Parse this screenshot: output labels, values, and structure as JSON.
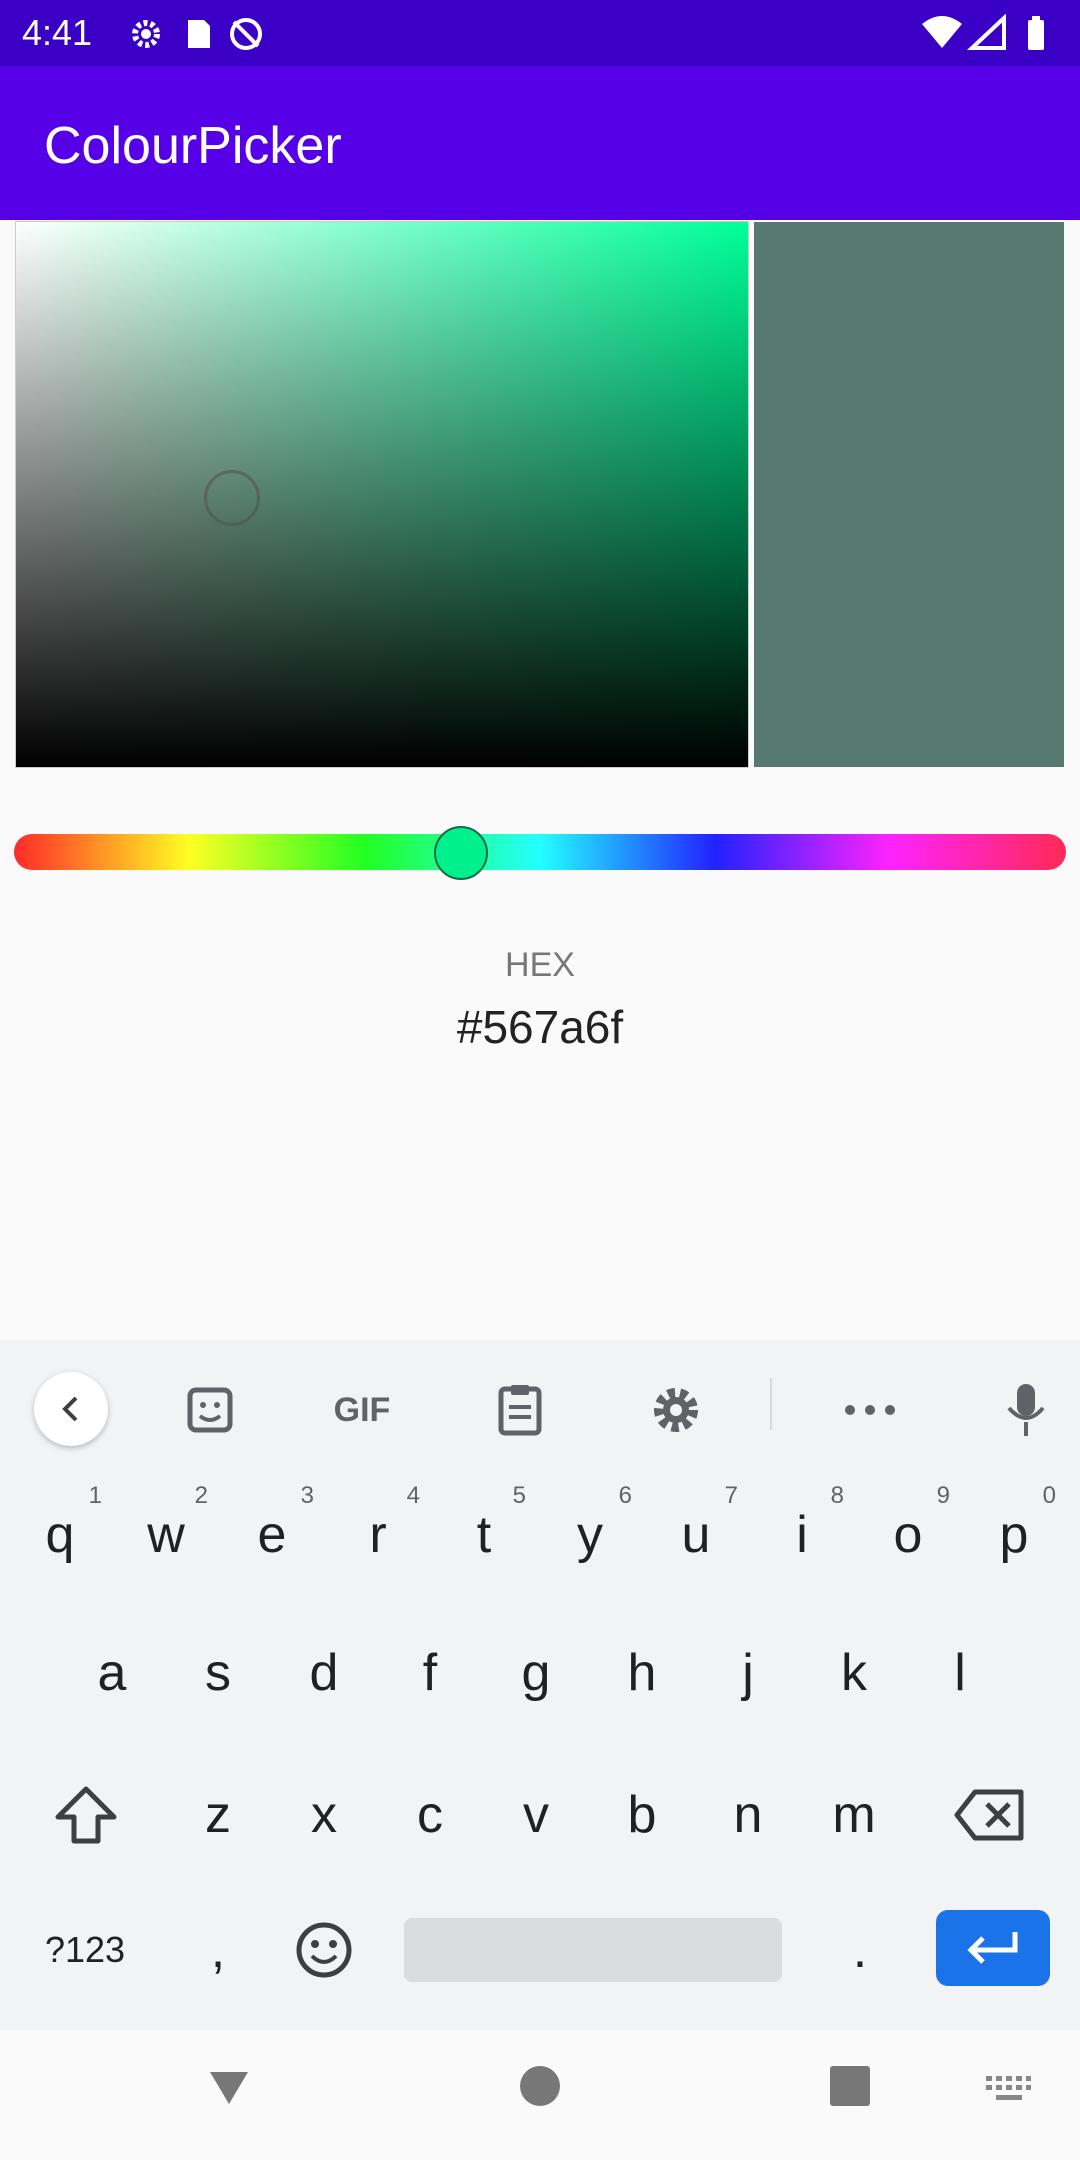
{
  "status_bar": {
    "time": "4:41",
    "icons_left": [
      "gear-icon",
      "sd-card-icon",
      "sync-off-icon"
    ],
    "icons_right": [
      "wifi-icon",
      "signal-icon",
      "battery-icon"
    ]
  },
  "app_bar": {
    "title": "ColourPicker"
  },
  "picker": {
    "base_hue_color": "#00ff99",
    "selected_color": "#567a6f",
    "hue_fraction": 0.43
  },
  "hex": {
    "label": "HEX",
    "value": "#567a6f"
  },
  "keyboard": {
    "toolbar": [
      "back-icon",
      "sticker-icon",
      "GIF",
      "clipboard-icon",
      "settings-icon",
      "more-icon",
      "mic-icon"
    ],
    "row1": [
      {
        "key": "q",
        "hint": "1"
      },
      {
        "key": "w",
        "hint": "2"
      },
      {
        "key": "e",
        "hint": "3"
      },
      {
        "key": "r",
        "hint": "4"
      },
      {
        "key": "t",
        "hint": "5"
      },
      {
        "key": "y",
        "hint": "6"
      },
      {
        "key": "u",
        "hint": "7"
      },
      {
        "key": "i",
        "hint": "8"
      },
      {
        "key": "o",
        "hint": "9"
      },
      {
        "key": "p",
        "hint": "0"
      }
    ],
    "row2": [
      "a",
      "s",
      "d",
      "f",
      "g",
      "h",
      "j",
      "k",
      "l"
    ],
    "row3": [
      "z",
      "x",
      "c",
      "v",
      "b",
      "n",
      "m"
    ],
    "row4": {
      "symbols": "?123",
      "comma": ",",
      "period": "."
    }
  },
  "nav_bar": [
    "back-nav-icon",
    "home-nav-icon",
    "recents-nav-icon",
    "keyboard-switch-icon"
  ]
}
